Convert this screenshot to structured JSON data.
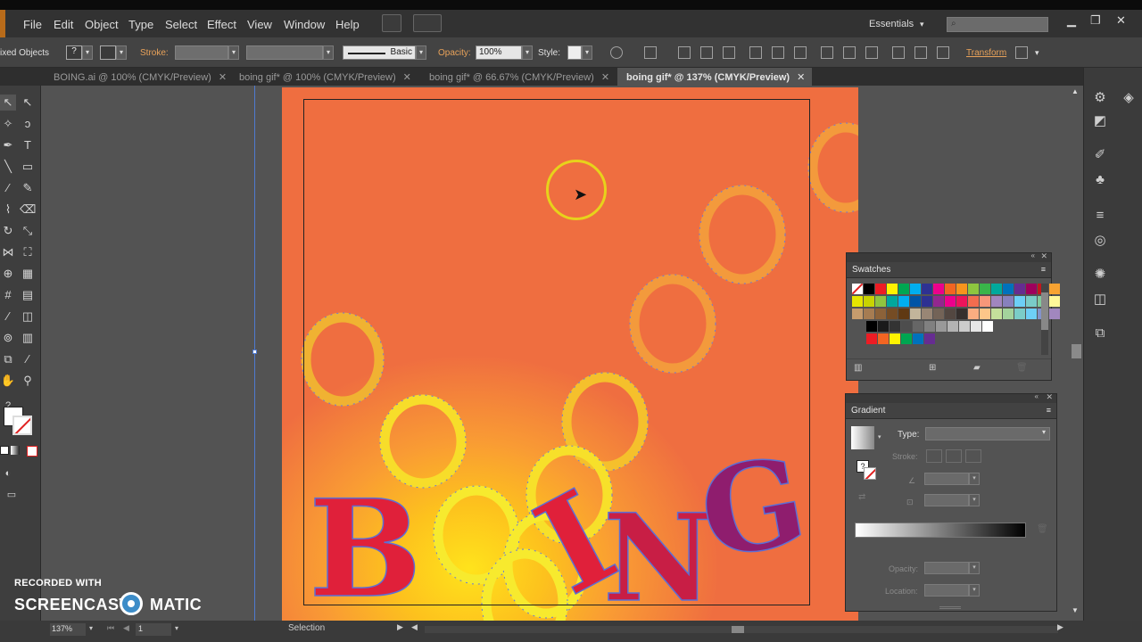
{
  "app": {
    "menus": [
      "File",
      "Edit",
      "Object",
      "Type",
      "Select",
      "Effect",
      "View",
      "Window",
      "Help"
    ],
    "workspace": "Essentials"
  },
  "control_bar": {
    "selection_label": "ixed Objects",
    "stroke_label": "Stroke:",
    "stroke_style": "Basic",
    "opacity_label": "Opacity:",
    "opacity_value": "100%",
    "style_label": "Style:",
    "transform_label": "Transform"
  },
  "tabs": [
    {
      "label": "BOING.ai @ 100% (CMYK/Preview)",
      "active": false
    },
    {
      "label": "boing gif* @ 100% (CMYK/Preview)",
      "active": false
    },
    {
      "label": "boing gif* @ 66.67% (CMYK/Preview)",
      "active": false
    },
    {
      "label": "boing gif* @ 137% (CMYK/Preview)",
      "active": true
    }
  ],
  "artwork": {
    "letters": [
      "B",
      "I",
      "N",
      "G"
    ],
    "colors": {
      "letter_red": "#e0203a",
      "letter_purple": "#8f1d6e",
      "o_yellow": "#f7ea2e",
      "o_orange": "#f39a3c",
      "bg_top": "#ef6e40",
      "bg_center": "#ffe31c"
    }
  },
  "swatches_panel": {
    "title": "Swatches",
    "colors": [
      [
        "#ffffff",
        "#000000",
        "#ed1c24",
        "#fff200",
        "#00a651",
        "#00aeef",
        "#2e3192",
        "#ec008c",
        "#f26522",
        "#f7941d",
        "#8dc63f",
        "#39b54a",
        "#00a99d",
        "#0072bc",
        "#662d91",
        "#9e005d",
        "#c4161c",
        "#f8a332"
      ],
      [
        "#e6e600",
        "#c8d400",
        "#90c53f",
        "#00a79d",
        "#00aeef",
        "#0054a6",
        "#2e3192",
        "#92278f",
        "#ec008c",
        "#ed145b",
        "#f26c4f",
        "#f7977a",
        "#a186be",
        "#8781bd",
        "#6dcff6",
        "#7accc8",
        "#82ca9c",
        "#fff799"
      ],
      [
        "#c69c6d",
        "#a67c52",
        "#8c6239",
        "#754c24",
        "#603913",
        "#c2b59b",
        "#998675",
        "#736357",
        "#534741",
        "#362f2d",
        "#f9ad81",
        "#fdc689",
        "#c4df9b",
        "#a3d39c",
        "#7bcdc8",
        "#6ecff6",
        "#8393ca",
        "#a187be"
      ],
      [
        "#000000",
        "#1a1a1a",
        "#333333",
        "#4d4d4d",
        "#666666",
        "#808080",
        "#999999",
        "#b3b3b3",
        "#cccccc",
        "#e6e6e6",
        "#ffffff"
      ],
      [
        "#ed1c24",
        "#f26522",
        "#fff200",
        "#00a651",
        "#0072bc",
        "#662d91"
      ]
    ]
  },
  "gradient_panel": {
    "title": "Gradient",
    "type_label": "Type:",
    "stroke_label": "Stroke:",
    "opacity_label": "Opacity:",
    "location_label": "Location:"
  },
  "status": {
    "zoom": "137%",
    "page": "1",
    "mode": "Selection"
  },
  "watermark": {
    "line1": "RECORDED WITH",
    "brand_left": "SCREENCAST",
    "brand_right": "MATIC"
  }
}
